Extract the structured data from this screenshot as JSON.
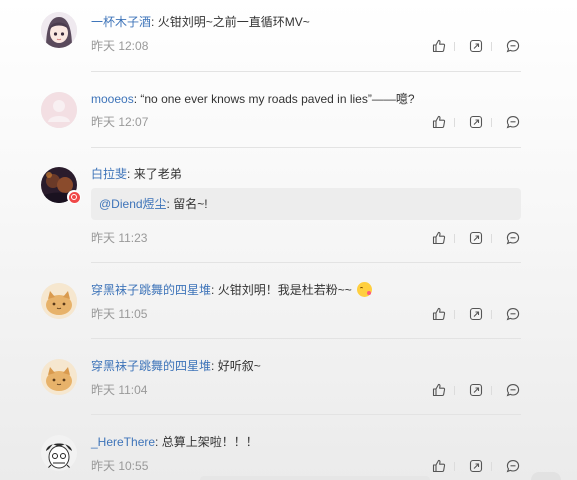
{
  "comments": [
    {
      "user": "一杯木子酒",
      "text": "火钳刘明~之前一直循环MV~",
      "time": "昨天 12:08",
      "avatar": "anime-girl-avatar"
    },
    {
      "user": "mooeos",
      "text": "“no one ever knows my roads paved in lies”——噫?",
      "time": "昨天 12:07",
      "avatar": "default-avatar"
    },
    {
      "user": "白拉斐",
      "text": "来了老弟",
      "time": "昨天 11:23",
      "avatar": "dark-photo-avatar",
      "quote_user": "@Diend煜尘",
      "quote_text": "留名~!"
    },
    {
      "user": "穿黑袜子跳舞的四星堆",
      "text": "火钳刘明！我是杜若粉~~",
      "time": "昨天 11:05",
      "avatar": "cat-avatar",
      "emoji": "kiss-emoji"
    },
    {
      "user": "穿黑袜子跳舞的四星堆",
      "text": "好听叙~",
      "time": "昨天 11:04",
      "avatar": "cat-avatar"
    },
    {
      "user": "_HereThere",
      "text": "总算上架啦！！！",
      "time": "昨天 10:55",
      "avatar": "sketch-avatar"
    }
  ],
  "separator": ":",
  "actions": [
    "like-icon",
    "share-icon",
    "reply-icon"
  ],
  "colors": {
    "username": "#3e74b9",
    "text": "#333333",
    "time": "#999999",
    "quote_bg": "#ededed",
    "divider": "#e3e3e3"
  }
}
